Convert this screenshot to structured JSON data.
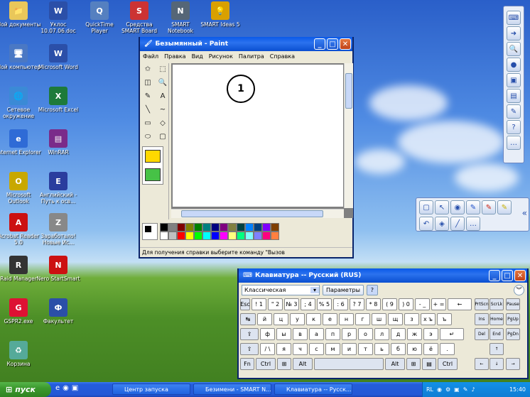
{
  "desktop_icons": [
    {
      "label": "Мой документы",
      "name": "my-documents-icon",
      "glyph": "📁",
      "color": "#e9c75a"
    },
    {
      "label": "Мой компьютер",
      "name": "my-computer-icon",
      "glyph": "🖥",
      "color": "#4a78c4"
    },
    {
      "label": "Сетевое окружение",
      "name": "network-icon",
      "glyph": "🌐",
      "color": "#3b8ad6"
    },
    {
      "label": "Internet Explorer",
      "name": "ie-icon",
      "glyph": "e",
      "color": "#2f6bd6"
    },
    {
      "label": "Microsoft Outlook",
      "name": "outlook-icon",
      "glyph": "O",
      "color": "#c8a800"
    },
    {
      "label": "Acrobat Reader 5.0",
      "name": "acrobat-icon",
      "glyph": "A",
      "color": "#c11"
    },
    {
      "label": "Raid Manager",
      "name": "raid-manager-icon",
      "glyph": "R",
      "color": "#333"
    },
    {
      "label": "GSPR2.exe",
      "name": "gspr-icon",
      "glyph": "G",
      "color": "#d13"
    },
    {
      "label": "Корзина",
      "name": "recycle-bin-icon",
      "glyph": "♻",
      "color": "#5a9"
    },
    {
      "label": "Уклос 10.07.06.doc",
      "name": "doc-file-icon",
      "glyph": "W",
      "color": "#2b4fa8"
    },
    {
      "label": "Microsoft Word",
      "name": "word-icon",
      "glyph": "W",
      "color": "#2b4fa8"
    },
    {
      "label": "Microsoft Excel",
      "name": "excel-icon",
      "glyph": "X",
      "color": "#1d7a3a"
    },
    {
      "label": "WinRAR",
      "name": "winrar-icon",
      "glyph": "▤",
      "color": "#7a2b8a"
    },
    {
      "label": "Английский - Путь к осв...",
      "name": "english-course-icon",
      "glyph": "E",
      "color": "#2a3d9e"
    },
    {
      "label": "Заработало! Новые Ис...",
      "name": "new-icon",
      "glyph": "Z",
      "color": "#888"
    },
    {
      "label": "Nero StartSmart",
      "name": "nero-icon",
      "glyph": "N",
      "color": "#c11"
    },
    {
      "label": "Факультет",
      "name": "faculty-icon",
      "glyph": "Ф",
      "color": "#2b4fa8"
    },
    {
      "label": "QuickTime Player",
      "name": "quicktime-icon",
      "glyph": "Q",
      "color": "#5580c0"
    },
    {
      "label": "Средства SMART Board",
      "name": "smart-board-icon",
      "glyph": "S",
      "color": "#c33"
    },
    {
      "label": "SMART Notebook",
      "name": "smart-notebook-icon",
      "glyph": "N",
      "color": "#567"
    },
    {
      "label": "SMART Ideas 5",
      "name": "smart-ideas-icon",
      "glyph": "💡",
      "color": "#d9a000"
    }
  ],
  "paint": {
    "title": "Безымянный - Paint",
    "menu": [
      "Файл",
      "Правка",
      "Вид",
      "Рисунок",
      "Палитра",
      "Справка"
    ],
    "status": "Для получения справки выберите команду \"Вызов",
    "tools": [
      "✩",
      "⬚",
      "◫",
      "🔍",
      "✎",
      "A",
      "╲",
      "~",
      "▭",
      "◇",
      "⬭",
      "▢"
    ],
    "palette": [
      "#000000",
      "#808080",
      "#800000",
      "#808000",
      "#008000",
      "#008080",
      "#000080",
      "#800080",
      "#808040",
      "#004040",
      "#0080ff",
      "#004080",
      "#8000ff",
      "#804000",
      "#ffffff",
      "#c0c0c0",
      "#ff0000",
      "#ffff00",
      "#00ff00",
      "#00ffff",
      "#0000ff",
      "#ff00ff",
      "#ffff80",
      "#00ff80",
      "#80ffff",
      "#8080ff",
      "#ff0080",
      "#ff8040"
    ],
    "marker": "1"
  },
  "keyboard": {
    "title": "Клавиатура -- Русский (RUS)",
    "layout": "Классическая",
    "params_button": "Параметры",
    "help_button": "?",
    "rows": [
      [
        "Esc",
        "! 1",
        "\" 2",
        "№ 3",
        "; 4",
        "% 5",
        ": 6",
        "? 7",
        "* 8",
        "( 9",
        ") 0",
        "- _",
        "+ =",
        "←"
      ],
      [
        "↹",
        "й",
        "ц",
        "у",
        "к",
        "е",
        "н",
        "г",
        "ш",
        "щ",
        "з",
        "х ъ",
        "ъ"
      ],
      [
        "⇪",
        "ф",
        "ы",
        "в",
        "а",
        "п",
        "р",
        "о",
        "л",
        "д",
        "ж",
        "э",
        "↵"
      ],
      [
        "⇧",
        "/ \\",
        "я",
        "ч",
        "с",
        "м",
        "и",
        "т",
        "ь",
        "б",
        "ю",
        "ё",
        "."
      ],
      [
        "Fn",
        "Ctrl",
        "⊞",
        "Alt",
        "",
        "Alt",
        "⊞",
        "▤",
        "Ctrl"
      ]
    ],
    "side_keys": [
      "PrtScn",
      "ScrLk",
      "Pause",
      "Ins",
      "Home",
      "PgUp",
      "Del",
      "End",
      "PgDn",
      "↑",
      "←",
      "↓",
      "→"
    ]
  },
  "taskbar": {
    "start": "пуск",
    "tasks": [
      "Центр запуска",
      "Безимени - SMART N...",
      "Клавиатура -- Русск..."
    ],
    "lang": "RL",
    "time": "15:40"
  },
  "colors": {
    "xp_blue": "#0a5ae8",
    "start_green": "#3c9a2e",
    "tray": "#0f8be0"
  }
}
